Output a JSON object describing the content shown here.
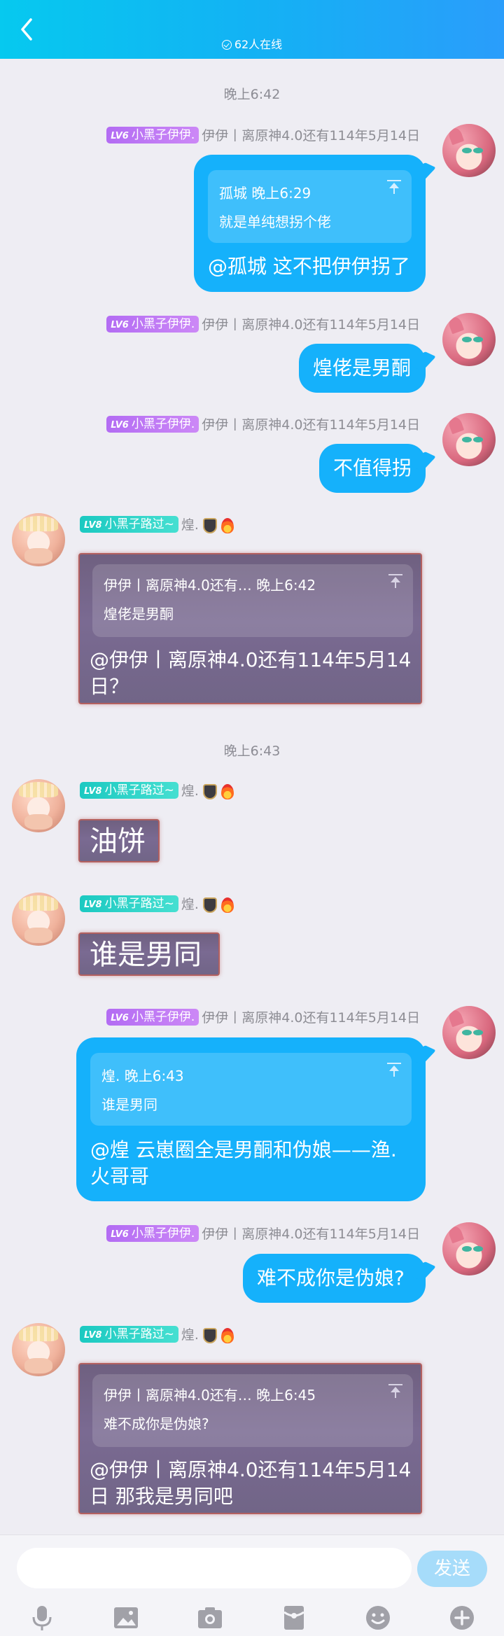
{
  "header": {
    "online_text": "62人在线"
  },
  "times": [
    "晚上6:42",
    "晚上6:43"
  ],
  "badges": {
    "self_level": "LV6",
    "self_title": "小黑子伊伊.",
    "other_level": "LV8",
    "other_title": "小黑子路过~"
  },
  "names": {
    "self": "伊伊丨离原神4.0还有114年5月14日",
    "other": "煌."
  },
  "messages": [
    {
      "quote_head": "孤城 晚上6:29",
      "quote_body": "就是单纯想拐个佬",
      "text": "@孤城 这不把伊伊拐了"
    },
    {
      "text": "煌佬是男酮"
    },
    {
      "text": "不值得拐"
    },
    {
      "quote_head": "伊伊丨离原神4.0还有…   晚上6:42",
      "quote_body": "煌佬是男酮",
      "text_line1": "@伊伊丨离原神4.0还有114年5月14",
      "text_line2": "日？"
    },
    {
      "text": "油饼"
    },
    {
      "text": "谁是男同"
    },
    {
      "quote_head": "煌. 晚上6:43",
      "quote_body": "谁是男同",
      "text_line1": "@煌 云崽圈全是男酮和伪娘——渔.",
      "text_line2": "火哥哥"
    },
    {
      "text": "难不成你是伪娘?"
    },
    {
      "quote_head": "伊伊丨离原神4.0还有…   晚上6:45",
      "quote_body": "难不成你是伪娘?",
      "text_line1": "@伊伊丨离原神4.0还有114年5月14",
      "text_line2": "日 那我是男同吧"
    }
  ],
  "composer": {
    "placeholder": "",
    "send_label": "发送"
  },
  "toolbar": [
    "microphone-icon",
    "image-icon",
    "camera-icon",
    "red-packet-icon",
    "emoji-icon",
    "plus-icon"
  ],
  "colors": {
    "bubble": "#15b1fb",
    "header": "#13b2f4",
    "send": "#a6dcfa"
  }
}
